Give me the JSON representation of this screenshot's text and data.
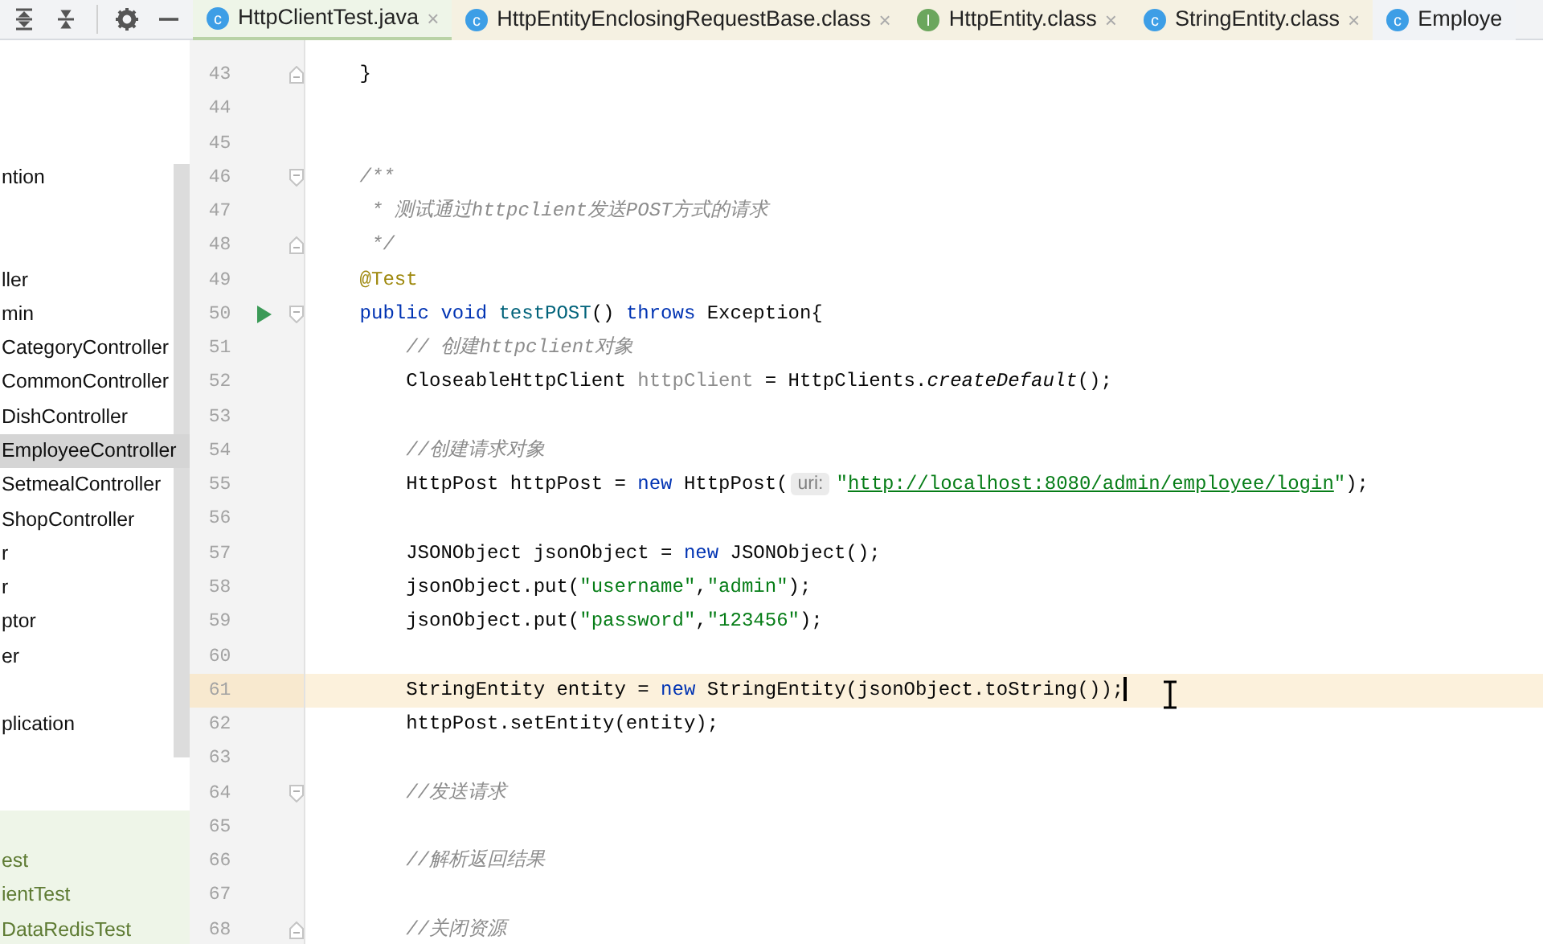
{
  "tabs": [
    {
      "label": "HttpClientTest.java",
      "icon_letter": "c",
      "kind": "project",
      "selected": true,
      "close": "×"
    },
    {
      "label": "HttpEntityEnclosingRequestBase.class",
      "icon_letter": "c",
      "kind": "library",
      "selected": false,
      "close": "×"
    },
    {
      "label": "HttpEntity.class",
      "icon_letter": "I",
      "kind": "library",
      "selected": false,
      "close": "×"
    },
    {
      "label": "StringEntity.class",
      "icon_letter": "c",
      "kind": "library",
      "selected": false,
      "close": "×"
    },
    {
      "label": "Employe",
      "icon_letter": "c",
      "kind": "project",
      "selected": false
    }
  ],
  "project_tree": [
    {
      "label": "ntion",
      "kind": "main",
      "selected": false
    },
    {
      "label": "ller",
      "kind": "main",
      "selected": false
    },
    {
      "label": "min",
      "kind": "main",
      "selected": false
    },
    {
      "label": "CategoryController",
      "kind": "main",
      "selected": false
    },
    {
      "label": "CommonController",
      "kind": "main",
      "selected": false
    },
    {
      "label": "DishController",
      "kind": "main",
      "selected": false
    },
    {
      "label": "EmployeeController",
      "kind": "main",
      "selected": true
    },
    {
      "label": "SetmealController",
      "kind": "main",
      "selected": false
    },
    {
      "label": "ShopController",
      "kind": "main",
      "selected": false
    },
    {
      "label": "r",
      "kind": "main",
      "selected": false
    },
    {
      "label": "r",
      "kind": "main",
      "selected": false
    },
    {
      "label": "ptor",
      "kind": "main",
      "selected": false
    },
    {
      "label": "er",
      "kind": "main",
      "selected": false
    },
    {
      "label": "plication",
      "kind": "main",
      "selected": false
    },
    {
      "label": "est",
      "kind": "test",
      "selected": false
    },
    {
      "label": "ientTest",
      "kind": "test",
      "selected": false
    },
    {
      "label": "DataRedisTest",
      "kind": "test",
      "selected": false
    }
  ],
  "editor_lines": [
    {
      "number": "43",
      "current": false,
      "run": false,
      "fold_start": false,
      "fold_end": true,
      "segments": [
        {
          "kind": "plain",
          "text": "    }"
        }
      ]
    },
    {
      "number": "44",
      "current": false,
      "run": false,
      "fold_start": false,
      "fold_end": false
    },
    {
      "number": "45",
      "current": false,
      "run": false,
      "fold_start": false,
      "fold_end": false
    },
    {
      "number": "46",
      "current": false,
      "run": false,
      "fold_start": true,
      "fold_end": false,
      "segments": [
        {
          "kind": "doc",
          "text": "    /**"
        }
      ]
    },
    {
      "number": "47",
      "current": false,
      "run": false,
      "fold_start": false,
      "fold_end": false,
      "segments": [
        {
          "kind": "doc",
          "text": "     * 测试通过httpclient发送POST方式的请求"
        }
      ]
    },
    {
      "number": "48",
      "current": false,
      "run": false,
      "fold_start": false,
      "fold_end": true,
      "segments": [
        {
          "kind": "doc",
          "text": "     */"
        }
      ]
    },
    {
      "number": "49",
      "current": false,
      "run": false,
      "fold_start": false,
      "fold_end": false,
      "segments": [
        {
          "kind": "annotation",
          "text": "    @Test"
        }
      ]
    },
    {
      "number": "50",
      "current": false,
      "run": true,
      "fold_start": true,
      "fold_end": false,
      "segments": [
        {
          "kind": "keyword",
          "text": "    public void "
        },
        {
          "kind": "declaration",
          "text": "testPOST"
        },
        {
          "kind": "plain",
          "text": "() "
        },
        {
          "kind": "keyword",
          "text": "throws"
        },
        {
          "kind": "plain",
          "text": " Exception{"
        }
      ]
    },
    {
      "number": "51",
      "current": false,
      "run": false,
      "fold_start": false,
      "fold_end": false,
      "segments": [
        {
          "kind": "comment",
          "text": "        // 创建httpclient对象"
        }
      ]
    },
    {
      "number": "52",
      "current": false,
      "run": false,
      "fold_start": false,
      "fold_end": false,
      "segments": [
        {
          "kind": "plain",
          "text": "        CloseableHttpClient "
        },
        {
          "kind": "unused",
          "text": "httpClient"
        },
        {
          "kind": "plain",
          "text": " = HttpClients."
        },
        {
          "kind": "static",
          "text": "createDefault"
        },
        {
          "kind": "plain",
          "text": "();"
        }
      ]
    },
    {
      "number": "53",
      "current": false,
      "run": false,
      "fold_start": false,
      "fold_end": false
    },
    {
      "number": "54",
      "current": false,
      "run": false,
      "fold_start": false,
      "fold_end": false,
      "segments": [
        {
          "kind": "comment",
          "text": "        //创建请求对象"
        }
      ]
    },
    {
      "number": "55",
      "current": false,
      "run": false,
      "fold_start": false,
      "fold_end": false,
      "segments": [
        {
          "kind": "plain",
          "text": "        HttpPost httpPost = "
        },
        {
          "kind": "keyword",
          "text": "new"
        },
        {
          "kind": "plain",
          "text": " HttpPost("
        },
        {
          "kind": "hint",
          "text": "uri:"
        },
        {
          "kind": "string",
          "text": "\""
        },
        {
          "kind": "url",
          "text": "http://localhost:8080/admin/employee/login"
        },
        {
          "kind": "string",
          "text": "\""
        },
        {
          "kind": "plain",
          "text": ");"
        }
      ]
    },
    {
      "number": "56",
      "current": false,
      "run": false,
      "fold_start": false,
      "fold_end": false
    },
    {
      "number": "57",
      "current": false,
      "run": false,
      "fold_start": false,
      "fold_end": false,
      "segments": [
        {
          "kind": "plain",
          "text": "        JSONObject jsonObject = "
        },
        {
          "kind": "keyword",
          "text": "new"
        },
        {
          "kind": "plain",
          "text": " JSONObject();"
        }
      ]
    },
    {
      "number": "58",
      "current": false,
      "run": false,
      "fold_start": false,
      "fold_end": false,
      "segments": [
        {
          "kind": "plain",
          "text": "        jsonObject.put("
        },
        {
          "kind": "string",
          "text": "\"username\""
        },
        {
          "kind": "plain",
          "text": ","
        },
        {
          "kind": "string",
          "text": "\"admin\""
        },
        {
          "kind": "plain",
          "text": ");"
        }
      ]
    },
    {
      "number": "59",
      "current": false,
      "run": false,
      "fold_start": false,
      "fold_end": false,
      "segments": [
        {
          "kind": "plain",
          "text": "        jsonObject.put("
        },
        {
          "kind": "string",
          "text": "\"password\""
        },
        {
          "kind": "plain",
          "text": ","
        },
        {
          "kind": "string",
          "text": "\"123456\""
        },
        {
          "kind": "plain",
          "text": ");"
        }
      ]
    },
    {
      "number": "60",
      "current": false,
      "run": false,
      "fold_start": false,
      "fold_end": false
    },
    {
      "number": "61",
      "current": true,
      "run": false,
      "fold_start": false,
      "fold_end": false,
      "segments": [
        {
          "kind": "plain",
          "text": "        StringEntity entity = "
        },
        {
          "kind": "keyword",
          "text": "new"
        },
        {
          "kind": "plain",
          "text": " StringEntity(jsonObject.toString());"
        }
      ]
    },
    {
      "number": "62",
      "current": false,
      "run": false,
      "fold_start": false,
      "fold_end": false,
      "segments": [
        {
          "kind": "plain",
          "text": "        httpPost.setEntity(entity);"
        }
      ]
    },
    {
      "number": "63",
      "current": false,
      "run": false,
      "fold_start": false,
      "fold_end": false
    },
    {
      "number": "64",
      "current": false,
      "run": false,
      "fold_start": true,
      "fold_end": false,
      "segments": [
        {
          "kind": "comment",
          "text": "        //发送请求"
        }
      ]
    },
    {
      "number": "65",
      "current": false,
      "run": false,
      "fold_start": false,
      "fold_end": false
    },
    {
      "number": "66",
      "current": false,
      "run": false,
      "fold_start": false,
      "fold_end": false,
      "segments": [
        {
          "kind": "comment",
          "text": "        //解析返回结果"
        }
      ]
    },
    {
      "number": "67",
      "current": false,
      "run": false,
      "fold_start": false,
      "fold_end": false
    },
    {
      "number": "68",
      "current": false,
      "run": false,
      "fold_start": false,
      "fold_end": true,
      "segments": [
        {
          "kind": "comment",
          "text": "        //关闭资源"
        }
      ]
    }
  ]
}
